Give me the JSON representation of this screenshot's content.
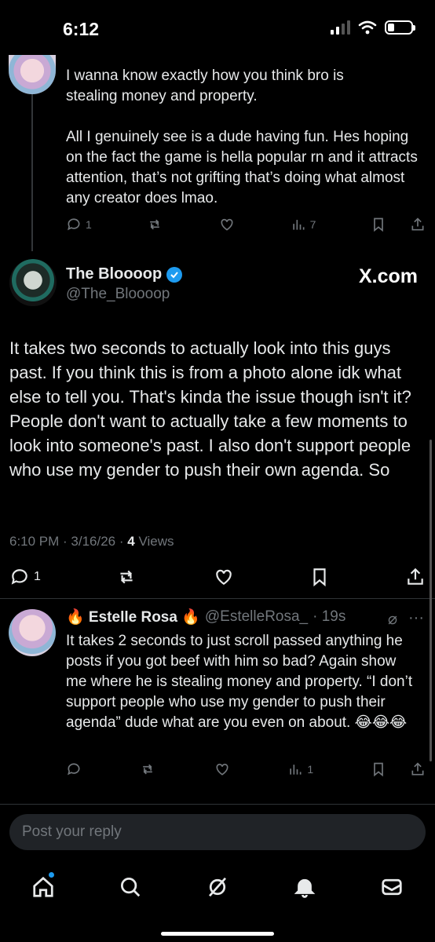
{
  "status_bar": {
    "time": "6:12"
  },
  "prev_post": {
    "text_1": "I wanna know exactly how you think bro is stealing money and property.",
    "text_2": "All I genuinely see is a dude having fun. Hes hoping on the fact the game is hella popular rn and it attracts attention, that’s not grifting that’s doing what almost any creator does lmao.",
    "reply_count": "1",
    "views": "7"
  },
  "main_post": {
    "display_name": "The Bloooop",
    "handle": "@The_Bloooop",
    "brand": "X.com",
    "text": "It takes two seconds to actually look into this guys past. If you think this is from a photo alone idk what else to tell you. That's kinda the issue though isn't it? People don't want to actually take a few moments to look into someone's past. I also don't support people who use my gender to push their own agenda. So",
    "timestamp": "6:10 PM · 3/16/26 · ",
    "views_count": "4",
    "views_label": "Views",
    "reply_count": "1"
  },
  "reply_post": {
    "display_name": "🔥 Estelle Rosa 🔥",
    "handle": "@EstelleRosa_",
    "time": "· 19s",
    "text": "It takes 2 seconds to just scroll passed anything he posts if you got beef with him so bad? Again show me where he is stealing money and property.  “I don’t support people who use my gender to push their agenda” dude what are you even on about. 😂😂😂",
    "views": "1"
  },
  "composer": {
    "placeholder": "Post your reply"
  },
  "colors": {
    "accent": "#1d9bf0",
    "muted": "#71767b",
    "text": "#e7e9ea",
    "background": "#000000"
  }
}
